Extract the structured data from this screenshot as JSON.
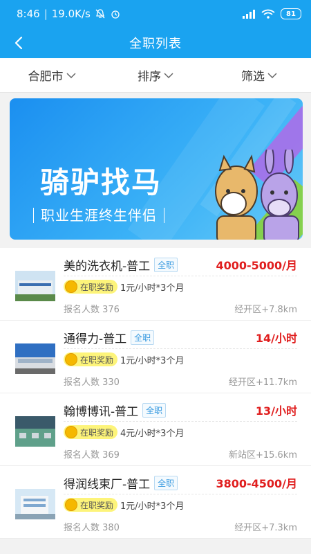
{
  "status": {
    "time": "8:46",
    "speed": "19.0K/s",
    "battery": "81"
  },
  "header": {
    "title": "全职列表"
  },
  "filters": [
    {
      "label": "合肥市"
    },
    {
      "label": "排序"
    },
    {
      "label": "筛选"
    }
  ],
  "banner": {
    "title": "骑驴找马",
    "subtitle": "职业生涯终生伴侣"
  },
  "jobs": [
    {
      "name": "美的洗衣机-普工",
      "tag": "全职",
      "salary": "4000-5000/月",
      "reward_badge": "在职奖励",
      "reward_text": "1元/小时*3个月",
      "count": "报名人数 376",
      "location": "经开区+7.8km"
    },
    {
      "name": "通得力-普工",
      "tag": "全职",
      "salary": "14/小时",
      "reward_badge": "在职奖励",
      "reward_text": "1元/小时*3个月",
      "count": "报名人数 330",
      "location": "经开区+11.7km"
    },
    {
      "name": "翰博博讯-普工",
      "tag": "全职",
      "salary": "13/小时",
      "reward_badge": "在职奖励",
      "reward_text": "4元/小时*3个月",
      "count": "报名人数 369",
      "location": "新站区+15.6km"
    },
    {
      "name": "得润线束厂-普工",
      "tag": "全职",
      "salary": "3800-4500/月",
      "reward_badge": "在职奖励",
      "reward_text": "1元/小时*3个月",
      "count": "报名人数 380",
      "location": "经开区+7.3km"
    }
  ],
  "colors": {
    "brand": "#1aa3f0",
    "salary": "#e01e1e",
    "tag": "#3a9be0",
    "reward_badge": "#fdf47a"
  }
}
